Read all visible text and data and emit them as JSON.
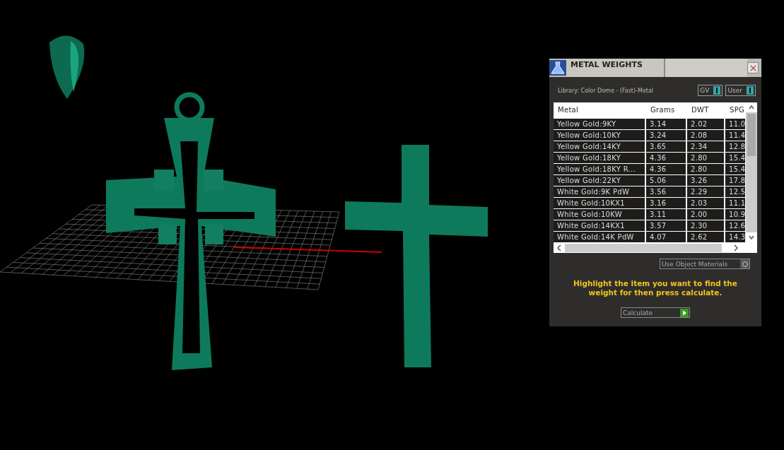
{
  "panel": {
    "title": "METAL WEIGHTS",
    "library": "Library: Color Dome - (Fast)-Metal",
    "toggles": [
      {
        "label": "GV",
        "on": true
      },
      {
        "label": "User",
        "on": true
      }
    ],
    "table": {
      "columns": [
        "Metal",
        "Grams",
        "DWT",
        "SPG"
      ],
      "rows": [
        [
          "Yellow Gold:9KY",
          "3.14",
          "2.02",
          "11.0"
        ],
        [
          "Yellow Gold:10KY",
          "3.24",
          "2.08",
          "11.4"
        ],
        [
          "Yellow Gold:14KY",
          "3.65",
          "2.34",
          "12.8"
        ],
        [
          "Yellow Gold:18KY",
          "4.36",
          "2.80",
          "15.4"
        ],
        [
          "Yellow Gold:18KY R...",
          "4.36",
          "2.80",
          "15.4"
        ],
        [
          "Yellow Gold:22KY",
          "5.06",
          "3.26",
          "17.8"
        ],
        [
          "White Gold:9K PdW",
          "3.56",
          "2.29",
          "12.5"
        ],
        [
          "White Gold:10KX1",
          "3.16",
          "2.03",
          "11.1"
        ],
        [
          "White Gold:10KW",
          "3.11",
          "2.00",
          "10.9"
        ],
        [
          "White Gold:14KX1",
          "3.57",
          "2.30",
          "12.6"
        ],
        [
          "White Gold:14K PdW",
          "4.07",
          "2.62",
          "14.3"
        ]
      ]
    },
    "object_materials": {
      "label": "Use Object Materials",
      "on": false
    },
    "hint": "Highlight the item you want to find the weight for then press calculate.",
    "calculate": "Calculate"
  }
}
